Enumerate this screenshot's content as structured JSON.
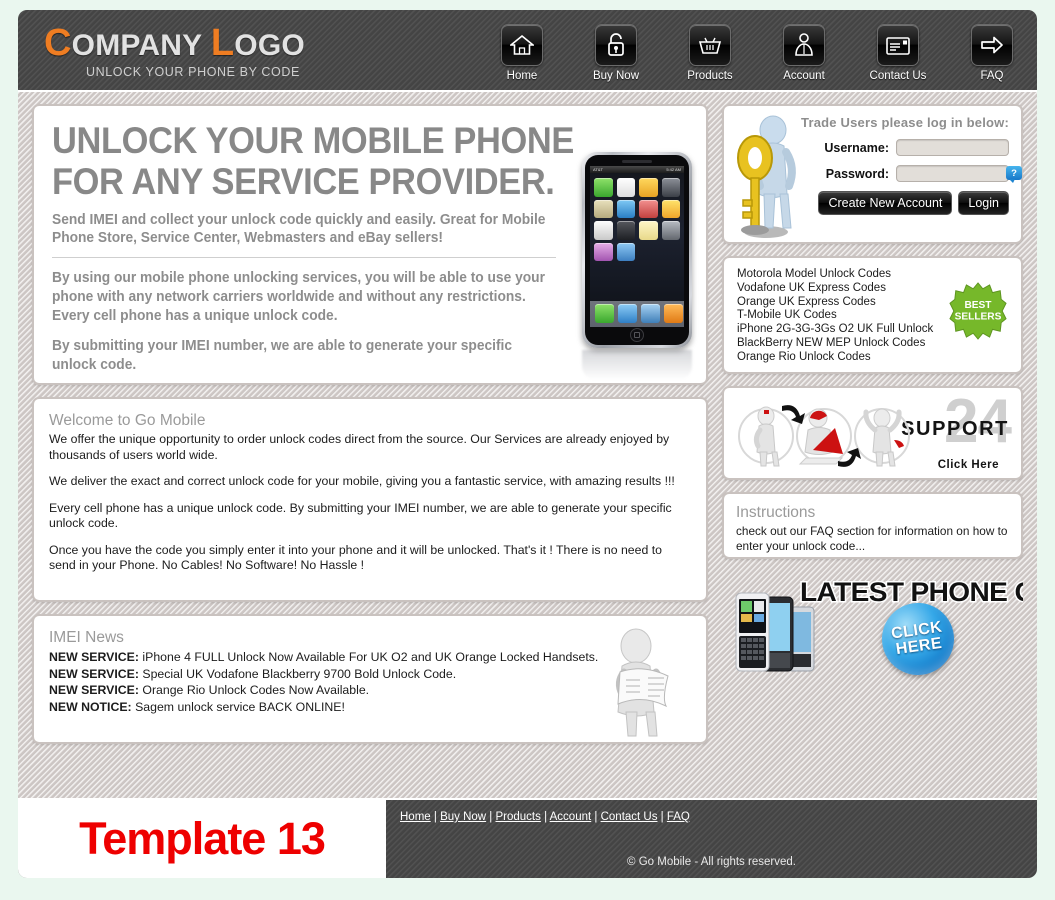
{
  "header": {
    "logo": {
      "word1_cap": "C",
      "word1_rest": "OMPANY",
      "word2_cap": "L",
      "word2_rest": "OGO",
      "tagline": "UNLOCK YOUR PHONE BY CODE",
      "accent_color": "#ef7d22"
    },
    "nav": [
      {
        "label": "Home",
        "icon": "home-icon"
      },
      {
        "label": "Buy Now",
        "icon": "padlock-icon"
      },
      {
        "label": "Products",
        "icon": "basket-icon"
      },
      {
        "label": "Account",
        "icon": "person-icon"
      },
      {
        "label": "Contact Us",
        "icon": "contact-card-icon"
      },
      {
        "label": "FAQ",
        "icon": "arrow-right-icon"
      }
    ]
  },
  "hero": {
    "heading": "UNLOCK YOUR MOBILE PHONE FOR ANY SERVICE PROVIDER.",
    "lead": "Send IMEI and collect your unlock code quickly and easily. Great for Mobile Phone Store, Service Center, Webmasters and eBay sellers!",
    "para1": "By using our mobile phone unlocking services, you will be able to use your phone with any network carriers worldwide and without any restrictions. Every cell phone has a unique unlock code.",
    "para2": "By submitting your IMEI number, we are able to generate your specific unlock code.",
    "phone_status_left": "AT&T",
    "phone_status_right": "5:42 AM"
  },
  "welcome": {
    "heading": "Welcome to Go Mobile",
    "paragraphs": [
      "We offer the unique opportunity to order unlock codes direct from the source. Our Services are already enjoyed by thousands of users world wide.",
      "We deliver the exact and correct unlock code for your mobile, giving you a fantastic service, with amazing results !!!",
      "Every cell phone has a unique unlock code. By submitting your IMEI number, we are able to generate your specific unlock code.",
      "Once you have the code you simply enter it into your phone and it will be unlocked. That's it ! There is no need to send in your Phone. No Cables! No Software! No Hassle !"
    ]
  },
  "news": {
    "heading": "IMEI News",
    "items": [
      {
        "tag": "NEW SERVICE:",
        "text": " iPhone 4 FULL Unlock Now Available For UK O2 and UK Orange Locked Handsets."
      },
      {
        "tag": "NEW SERVICE:",
        "text": " Special UK Vodafone Blackberry 9700 Bold Unlock Code."
      },
      {
        "tag": "NEW SERVICE:",
        "text": " Orange Rio Unlock Codes Now Available."
      },
      {
        "tag": "NEW NOTICE:",
        "text": " Sagem unlock service BACK ONLINE!"
      }
    ]
  },
  "login": {
    "title": "Trade Users please log in below:",
    "username_label": "Username:",
    "username_value": "",
    "username_placeholder": "",
    "password_label": "Password:",
    "password_value": "",
    "password_placeholder": "",
    "help_glyph": "?",
    "create_label": "Create New Account",
    "login_label": "Login"
  },
  "sellers": {
    "items": [
      "Motorola Model Unlock Codes",
      "Vodafone UK Express Codes",
      "Orange UK Express Codes",
      "T-Mobile UK Codes",
      "iPhone 2G-3G-3Gs O2 UK Full Unlock",
      "BlackBerry NEW MEP Unlock Codes",
      "Orange Rio Unlock Codes"
    ],
    "badge_line1": "BEST",
    "badge_line2": "SELLERS",
    "badge_color": "#76b82a"
  },
  "support": {
    "number": "24",
    "word": "SUPPORT",
    "click": "Click Here"
  },
  "instructions": {
    "heading": "Instructions",
    "text": "check out our FAQ section for information on how to enter your unlock code..."
  },
  "latest": {
    "title": "LATEST PHONE CODES",
    "click_line1": "CLICK",
    "click_line2": "HERE"
  },
  "footer": {
    "template_label": "Template 13",
    "template_color": "#ee0000",
    "links": [
      "Home",
      "Buy Now",
      "Products",
      "Account",
      "Contact Us",
      "FAQ"
    ],
    "separator": " | ",
    "copyright": "© Go Mobile - All rights reserved."
  }
}
